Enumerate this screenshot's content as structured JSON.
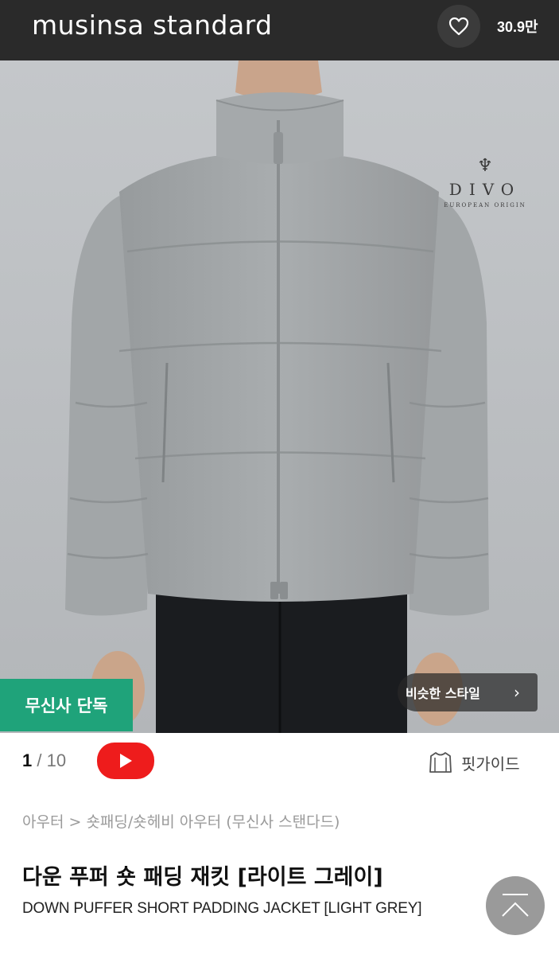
{
  "header": {
    "brand": "musinsa standard",
    "likes": "30.9만",
    "icons": {
      "like": "heart-icon"
    }
  },
  "hero": {
    "watermark": {
      "name": "DIVO",
      "tagline": "EUROPEAN ORIGIN"
    },
    "badge": "무신사 단독",
    "similar_style": "비슷한 스타일",
    "icons": {
      "similar": "chevron-right-icon"
    }
  },
  "gallery": {
    "current": "1",
    "separator": "/",
    "total": "10",
    "icons": {
      "video": "play-icon"
    }
  },
  "fit_guide": {
    "label": "핏가이드",
    "icon": "shirt-icon"
  },
  "product": {
    "breadcrumb": "아우터 > 숏패딩/숏헤비 아우터 (무신사 스탠다드)",
    "title_ko": "다운 푸퍼 숏 패딩 재킷 [라이트 그레이]",
    "title_en": "DOWN PUFFER SHORT PADDING JACKET [LIGHT GREY]"
  },
  "scroll_top": {
    "icon": "scroll-to-top-icon"
  },
  "colors": {
    "header_bg": "#2a2a2a",
    "exclusive_badge": "#1fa37a",
    "youtube_red": "#ee1c1c",
    "jacket": "#a4a8aa"
  }
}
